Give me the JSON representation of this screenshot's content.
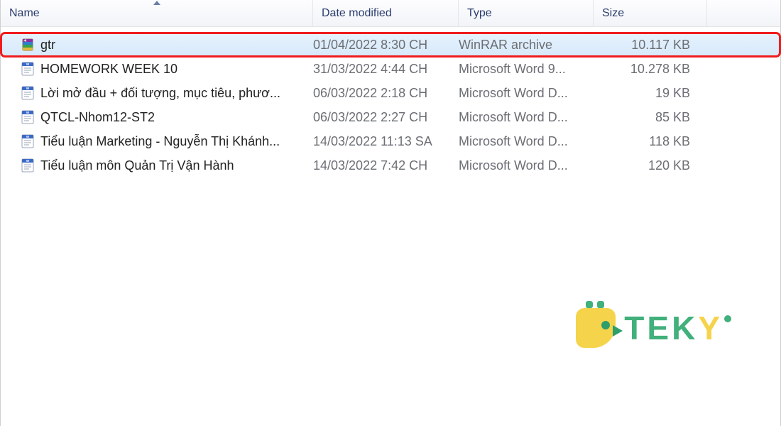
{
  "columns": {
    "name": "Name",
    "date": "Date modified",
    "type": "Type",
    "size": "Size"
  },
  "files": [
    {
      "icon": "rar",
      "name": "gtr",
      "date": "01/04/2022 8:30 CH",
      "type": "WinRAR archive",
      "size": "10.117 KB",
      "selected": true,
      "highlighted": true
    },
    {
      "icon": "word",
      "name": "HOMEWORK WEEK 10",
      "date": "31/03/2022 4:44 CH",
      "type": "Microsoft Word 9...",
      "size": "10.278 KB",
      "selected": false,
      "highlighted": false
    },
    {
      "icon": "word",
      "name": "Lời mở đầu + đối tượng, mục tiêu, phươ...",
      "date": "06/03/2022 2:18 CH",
      "type": "Microsoft Word D...",
      "size": "19 KB",
      "selected": false,
      "highlighted": false
    },
    {
      "icon": "word",
      "name": "QTCL-Nhom12-ST2",
      "date": "06/03/2022 2:27 CH",
      "type": "Microsoft Word D...",
      "size": "85 KB",
      "selected": false,
      "highlighted": false
    },
    {
      "icon": "word",
      "name": "Tiểu luận Marketing - Nguyễn Thị Khánh...",
      "date": "14/03/2022 11:13 SA",
      "type": "Microsoft Word D...",
      "size": "118 KB",
      "selected": false,
      "highlighted": false
    },
    {
      "icon": "word",
      "name": "Tiểu luận môn Quản Trị Vận Hành",
      "date": "14/03/2022 7:42 CH",
      "type": "Microsoft Word D...",
      "size": "120 KB",
      "selected": false,
      "highlighted": false
    }
  ],
  "watermark": {
    "text": "TEKY"
  }
}
